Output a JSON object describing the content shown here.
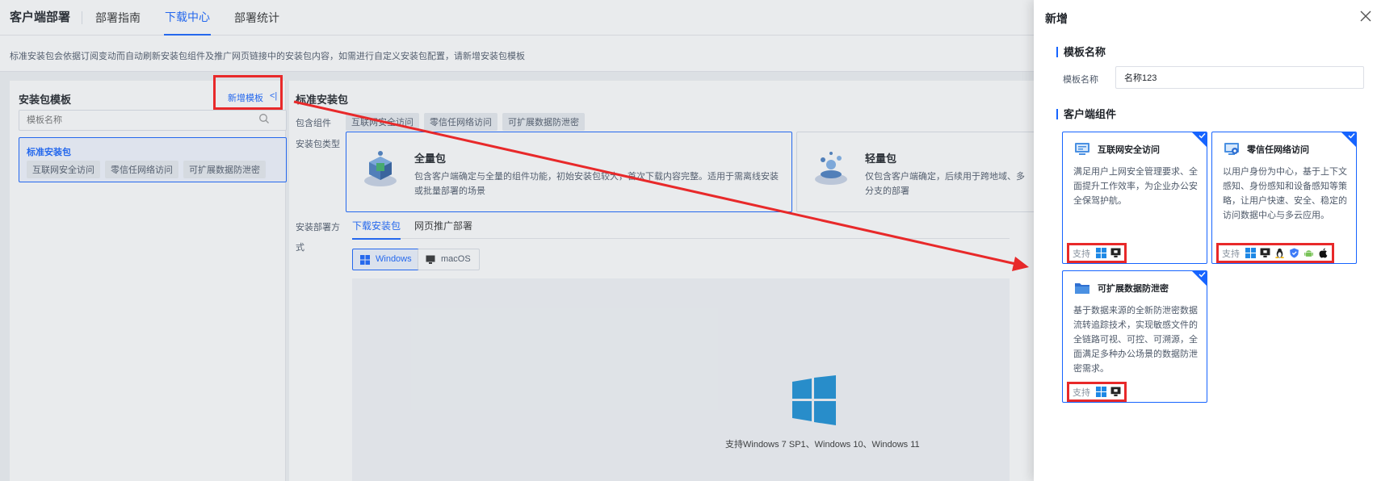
{
  "nav": {
    "brand": "客户端部署",
    "tabs": [
      "部署指南",
      "下载中心",
      "部署统计"
    ],
    "active_tab": "下载中心"
  },
  "notice": "标准安装包会依据订阅变动而自动刷新安装包组件及推广网页链接中的安装包内容，如需进行自定义安装包配置，请新增安装包模板",
  "left_panel": {
    "title": "安装包模板",
    "new_button": "新增模板",
    "collapse_icon": "collapse-left-icon",
    "search_placeholder": "模板名称",
    "templates": [
      {
        "name": "标准安装包",
        "tags": [
          "互联网安全访问",
          "零信任网络访问",
          "可扩展数据防泄密"
        ]
      }
    ]
  },
  "main_panel": {
    "title": "标准安装包",
    "components_label": "包含组件",
    "components": [
      "互联网安全访问",
      "零信任网络访问",
      "可扩展数据防泄密"
    ],
    "type_label": "安装包类型",
    "types": [
      {
        "name": "全量包",
        "desc": "包含客户端确定与全量的组件功能，初始安装包较大，首次下载内容完整。适用于需离线安装或批量部署的场景"
      },
      {
        "name": "轻量包",
        "desc": "仅包含客户端确定，后续用于跨地域、多分支的部署"
      }
    ],
    "deploy_label_1": "安装部署方",
    "deploy_label_2": "式",
    "deploy_tabs": [
      "下载安装包",
      "网页推广部署"
    ],
    "os_buttons": [
      "Windows",
      "macOS"
    ],
    "preview_text": "支持Windows 7 SP1、Windows 10、Windows 11"
  },
  "drawer": {
    "title": "新增",
    "close_icon": "close-icon",
    "section_template": "模板名称",
    "field_label": "模板名称",
    "field_value": "名称123",
    "section_components": "客户端组件",
    "support_label": "支持",
    "cards": [
      {
        "name": "互联网安全访问",
        "icon": "monitor-shield-icon",
        "desc": "满足用户上网安全管理要求、全面提升工作效率，为企业办公安全保驾护航。",
        "platforms": [
          "windows",
          "desktop"
        ]
      },
      {
        "name": "零信任网络访问",
        "icon": "monitor-network-icon",
        "desc": "以用户身份为中心，基于上下文感知、身份感知和设备感知等策略，让用户快速、安全、稳定的访问数据中心与多云应用。",
        "platforms": [
          "windows",
          "desktop",
          "linux",
          "shield",
          "android",
          "apple"
        ]
      },
      {
        "name": "可扩展数据防泄密",
        "icon": "folder-icon",
        "desc": "基于数据来源的全新防泄密数据流转追踪技术，实现敏感文件的全链路可视、可控、可溯源，全面满足多种办公场景的数据防泄密需求。",
        "platforms": [
          "windows",
          "desktop"
        ]
      }
    ]
  },
  "colors": {
    "accent": "#1664ff",
    "highlight": "#e8292a",
    "windows": "#1e88e5",
    "android": "#78c257"
  }
}
